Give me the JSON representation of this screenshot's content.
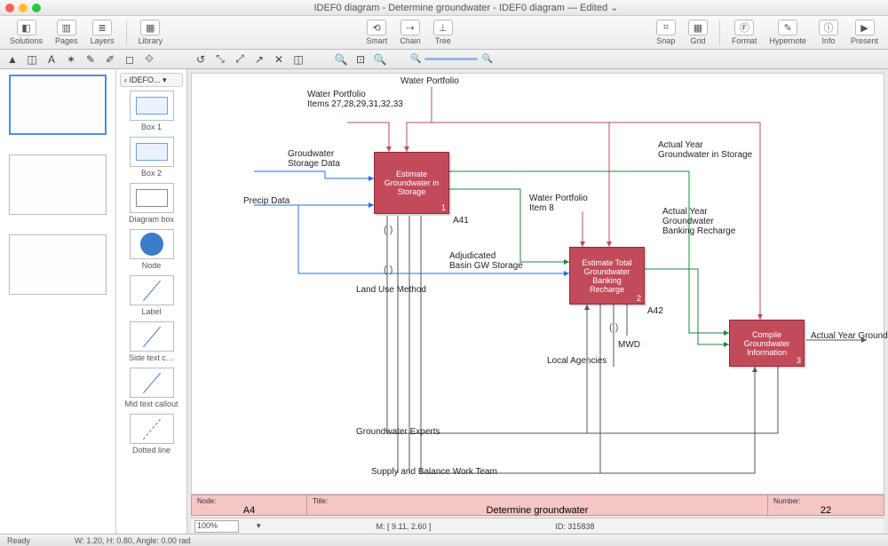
{
  "window": {
    "title": "IDEF0 diagram - Determine groundwater - IDEF0 diagram — Edited ⌄"
  },
  "toolbar": {
    "solutions": "Solutions",
    "pages": "Pages",
    "layers": "Layers",
    "library": "Library",
    "smart": "Smart",
    "chain": "Chain",
    "tree": "Tree",
    "snap": "Snap",
    "grid": "Grid",
    "format": "Format",
    "hypernote": "Hypernote",
    "info": "Info",
    "present": "Present"
  },
  "library": {
    "crumb": "‹  IDEFO...  ▾",
    "items": [
      "Box 1",
      "Box 2",
      "Diagram box",
      "Node",
      "Label",
      "Side text c…",
      "Mid text callout",
      "Dotted line"
    ]
  },
  "diagram": {
    "labels": {
      "waterPortfolio": "Water Portfolio",
      "waterPortfolioItems": "Water Portfolio\nItems 27,28,29,31,32,33",
      "storageData": "Groudwater\nStorage Data",
      "precip": "Precip Data",
      "landUse": "Land Use Method",
      "adjBasin": "Adjudicated\nBasin GW Storage",
      "wpItem8": "Water Portfolio\nItem 8",
      "actualStorage": "Actual Year\nGroundwater in Storage",
      "actualRecharge": "Actual Year\nGroundwater\nBanking Recharge",
      "mwd": "MWD",
      "localAgencies": "Local Agencies",
      "gwExperts": "Groundwater Experts",
      "supplyTeam": "Supply and Balance Work Team",
      "actualGW": "Actual Year Groundwater",
      "a41": "A41",
      "a42": "A42"
    },
    "boxes": {
      "b1": {
        "title": "Estimate\nGroundwater in\nStorage",
        "num": "1"
      },
      "b2": {
        "title": "Estimate Total\nGroundwater\nBanking\nRecharge",
        "num": "2"
      },
      "b3": {
        "title": "Compile\nGroundwater\nInformation",
        "num": "3"
      }
    }
  },
  "footer": {
    "nodeLab": "Node:",
    "nodeVal": "A4",
    "titleLab": "Title:",
    "titleVal": "Determine groundwater",
    "numLab": "Number:",
    "numVal": "22"
  },
  "bottombar": {
    "zoom": "100%",
    "m": "M: [ 9.11, 2.60 ]",
    "id": "ID: 315838"
  },
  "status": {
    "ready": "Ready",
    "dims": "W: 1.20,   H: 0.80,   Angle: 0.00 rad"
  }
}
